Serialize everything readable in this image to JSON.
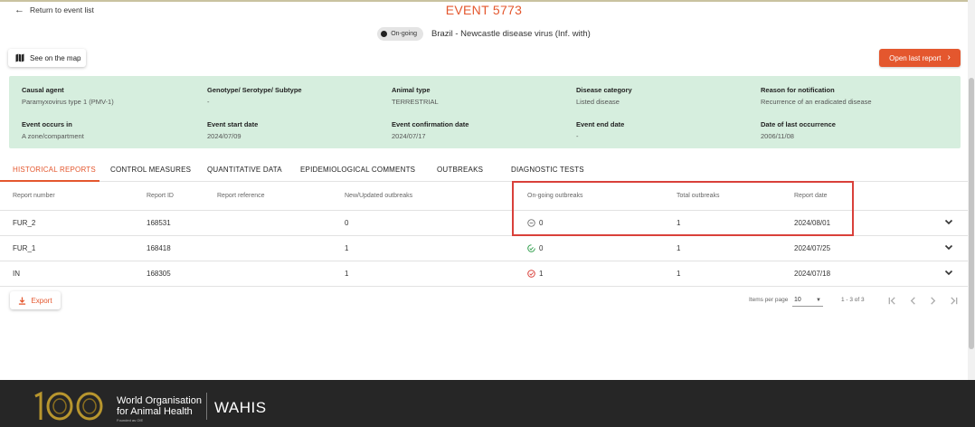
{
  "header": {
    "return_label": "Return to event list",
    "event_title": "EVENT 5773",
    "status_chip": "On-going",
    "subtitle": "Brazil - Newcastle disease virus (Inf. with)"
  },
  "actions": {
    "map_label": "See on the map",
    "open_report_label": "Open last report"
  },
  "info": {
    "causal_agent": {
      "label": "Causal agent",
      "value": "Paramyxovirus type 1 (PMV-1)"
    },
    "genotype": {
      "label": "Genotype/ Serotype/ Subtype",
      "value": "-"
    },
    "animal_type": {
      "label": "Animal type",
      "value": "TERRESTRIAL"
    },
    "disease_category": {
      "label": "Disease category",
      "value": "Listed disease"
    },
    "reason": {
      "label": "Reason for notification",
      "value": "Recurrence of an eradicated disease"
    },
    "event_occurs_in": {
      "label": "Event occurs in",
      "value": "A zone/compartment"
    },
    "start_date": {
      "label": "Event start date",
      "value": "2024/07/09"
    },
    "confirmation_date": {
      "label": "Event confirmation date",
      "value": "2024/07/17"
    },
    "end_date": {
      "label": "Event end date",
      "value": "-"
    },
    "last_occurrence": {
      "label": "Date of last occurrence",
      "value": "2006/11/08"
    }
  },
  "tabs": [
    {
      "label": "HISTORICAL REPORTS",
      "active": true
    },
    {
      "label": "CONTROL MEASURES",
      "active": false
    },
    {
      "label": "QUANTITATIVE DATA",
      "active": false
    },
    {
      "label": "EPIDEMIOLOGICAL COMMENTS",
      "active": false
    },
    {
      "label": "OUTBREAKS",
      "active": false
    },
    {
      "label": "DIAGNOSTIC TESTS",
      "active": false
    }
  ],
  "table": {
    "headers": {
      "report_number": "Report number",
      "report_id": "Report ID",
      "report_reference": "Report reference",
      "new_outbreaks": "New/Updated outbreaks",
      "ongoing_outbreaks": "On-going outbreaks",
      "total_outbreaks": "Total outbreaks",
      "report_date": "Report date"
    },
    "rows": [
      {
        "report_number": "FUR_2",
        "report_id": "168531",
        "report_reference": "",
        "new_outbreaks": "0",
        "ongoing_outbreaks": "0",
        "total_outbreaks": "1",
        "report_date": "2024/08/01",
        "status_icon": "neutral-circle-icon"
      },
      {
        "report_number": "FUR_1",
        "report_id": "168418",
        "report_reference": "",
        "new_outbreaks": "1",
        "ongoing_outbreaks": "0",
        "total_outbreaks": "1",
        "report_date": "2024/07/25",
        "status_icon": "resolving-circle-icon"
      },
      {
        "report_number": "IN",
        "report_id": "168305",
        "report_reference": "",
        "new_outbreaks": "1",
        "ongoing_outbreaks": "1",
        "total_outbreaks": "1",
        "report_date": "2024/07/18",
        "status_icon": "active-circle-icon"
      }
    ]
  },
  "pagination": {
    "export_label": "Export",
    "items_per_page_label": "Items per page",
    "items_per_page_value": "10",
    "range_label": "1 - 3 of 3"
  },
  "footer": {
    "org_line1": "World Organisation",
    "org_line2": "for Animal Health",
    "org_sub": "Founded as OIE",
    "product": "WAHIS"
  },
  "colors": {
    "accent": "#e4572e",
    "info_panel": "#d6eede",
    "footer_bg": "#262626",
    "highlight_box": "#d9403a",
    "status_green": "#2e9e4a",
    "status_red": "#d9403a"
  }
}
